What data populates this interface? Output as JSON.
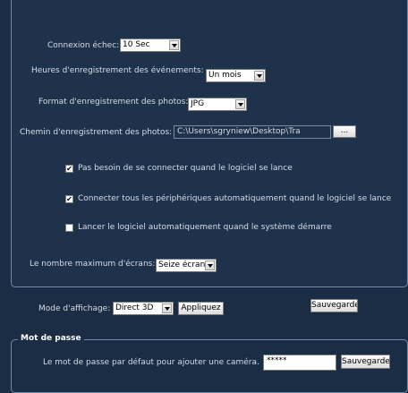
{
  "settings": {
    "failed_connection": {
      "label": "Connexion échec:",
      "value": "10 Sec"
    },
    "event_hours": {
      "label": "Heures d'enregistrement des événements:",
      "value": "Un mois"
    },
    "photo_format": {
      "label": "Format d'enregistrement des photos:",
      "value": "JPG"
    },
    "photo_path": {
      "label": "Chemin d'enregistrement des photos:",
      "value": "C:\\Users\\sgryniew\\Desktop\\Tra",
      "browse_label": "..."
    },
    "checkboxes": [
      {
        "label": "Pas besoin de se connecter quand le logiciel se lance",
        "checked": true
      },
      {
        "label": "Connecter tous les périphériques automatiquement quand le logiciel se lance",
        "checked": true
      },
      {
        "label": "Lancer le logiciel automatiquement quand le système démarre",
        "checked": false
      }
    ],
    "max_screens": {
      "label": "Le nombre maximum d'écrans:",
      "value": "Seize écran"
    }
  },
  "display": {
    "label": "Mode d'affichage:",
    "value": "Direct 3D",
    "apply_label": "Appliquez",
    "save_label": "Sauvegarder"
  },
  "password": {
    "group_title": "Mot de passe",
    "label": "Le mot de passe par défaut pour ajouter une caméra.",
    "value": "*****",
    "save_label": "Sauvegarder"
  }
}
